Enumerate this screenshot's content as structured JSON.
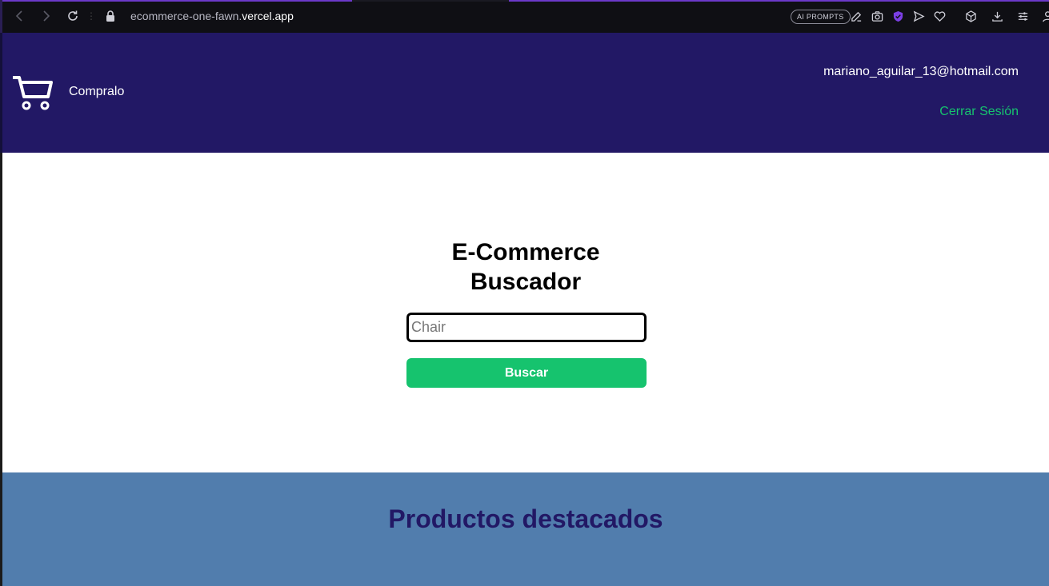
{
  "browser": {
    "url_prefix": "ecommerce-one-fawn.",
    "url_host": "vercel.app",
    "ai_badge": "AI PROMPTS",
    "icons": [
      "back-icon",
      "forward-icon",
      "reload-icon",
      "lock-icon",
      "edit-icon",
      "camera-icon",
      "shield-icon",
      "send-icon",
      "heart-icon",
      "cube-icon",
      "download-icon",
      "settings-icon",
      "profile-icon"
    ],
    "accent": "#6b39c9"
  },
  "header": {
    "brand": "Compralo",
    "user_email": "mariano_aguilar_13@hotmail.com",
    "logout_label": "Cerrar Sesión",
    "background": "#221865",
    "logout_color": "#16c36e"
  },
  "search": {
    "title_line1": "E-Commerce",
    "title_line2": "Buscador",
    "placeholder": "Chair",
    "button_label": "Buscar",
    "button_color": "#16c36e"
  },
  "featured": {
    "title": "Productos destacados",
    "background": "#517dad"
  }
}
